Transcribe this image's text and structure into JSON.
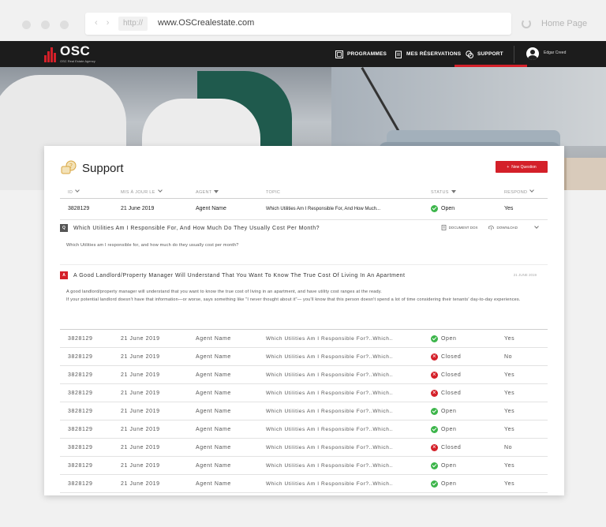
{
  "browser": {
    "protocol": "http://",
    "address": "www.OSCrealestate.com",
    "home_label": "Home Page"
  },
  "app": {
    "logo_text": "OSC",
    "logo_sub": "OSC Real Estate Agency",
    "nav": [
      {
        "label": "PROGRAMMES",
        "icon": "grid-icon"
      },
      {
        "label": "MES RÉSERVATIONS",
        "icon": "clipboard-icon"
      },
      {
        "label": "SUPPORT",
        "icon": "chat-icon",
        "active": true
      }
    ],
    "user_name": "Edgar Creed"
  },
  "page": {
    "title": "Support",
    "new_question_label": "New Question"
  },
  "table": {
    "headers": [
      "ID",
      "MIS À JOUR LE",
      "AGENT",
      "TOPIC",
      "STATUS",
      "RESPOND"
    ],
    "first_row": {
      "id": "3828129",
      "date": "21 June 2019",
      "agent": "Agent Name",
      "topic": "Which Utilities Am I Responsible For, And How Much...",
      "status": "Open",
      "respond": "Yes"
    },
    "rows": [
      {
        "id": "3828129",
        "date": "21 June 2019",
        "agent": "Agent Name",
        "topic": "Which Utilities Am I Responsible For?..Which..",
        "status": "Open",
        "respond": "Yes"
      },
      {
        "id": "3828129",
        "date": "21 June 2019",
        "agent": "Agent Name",
        "topic": "Which Utilities Am I Responsible For?..Which..",
        "status": "Closed",
        "respond": "No"
      },
      {
        "id": "3828129",
        "date": "21 June 2019",
        "agent": "Agent Name",
        "topic": "Which Utilities Am I Responsible For?..Which..",
        "status": "Closed",
        "respond": "Yes"
      },
      {
        "id": "3828129",
        "date": "21 June 2019",
        "agent": "Agent Name",
        "topic": "Which Utilities Am I Responsible For?..Which..",
        "status": "Closed",
        "respond": "Yes"
      },
      {
        "id": "3828129",
        "date": "21 June 2019",
        "agent": "Agent Name",
        "topic": "Which Utilities Am I Responsible For?..Which..",
        "status": "Open",
        "respond": "Yes"
      },
      {
        "id": "3828129",
        "date": "21 June 2019",
        "agent": "Agent Name",
        "topic": "Which Utilities Am I Responsible For?..Which..",
        "status": "Open",
        "respond": "Yes"
      },
      {
        "id": "3828129",
        "date": "21 June 2019",
        "agent": "Agent Name",
        "topic": "Which Utilities Am I Responsible For?..Which..",
        "status": "Closed",
        "respond": "No"
      },
      {
        "id": "3828129",
        "date": "21 June 2019",
        "agent": "Agent Name",
        "topic": "Which Utilities Am I Responsible For?..Which..",
        "status": "Open",
        "respond": "Yes"
      },
      {
        "id": "3828129",
        "date": "21 June 2019",
        "agent": "Agent Name",
        "topic": "Which Utilities Am I Responsible For?..Which..",
        "status": "Open",
        "respond": "Yes"
      }
    ]
  },
  "expanded": {
    "question_badge": "Q",
    "question_title": "Which Utilities Am I Responsible For, And How Much Do They Usually Cost Per Month?",
    "document_label": "DOCUMENT DOX",
    "download_label": "DOWNLOAD",
    "question_text": "Which Utilities am I responsible for, and how much do they usually cost per month?",
    "answer_badge": "A",
    "answer_title": "A Good Landlord/Property Manager Will Understand That You Want To Know The True Cost Of Living In An Apartment",
    "answer_date": "21 JUNE 2019",
    "answer_text_1": "A good landlord/property manager will understand that you want to know the true cost of living in an apartment, and have utility cost ranges at the ready.",
    "answer_text_2": "If your potential landlord doesn't have that information—or worse, says something like \"I never thought about it\"— you'll know that this person doesn't spend a lot of time considering their tenants' day-to-day experiences."
  },
  "colors": {
    "accent": "#d42029",
    "open": "#3cb54a",
    "closed": "#d42029",
    "navbar": "#1c1c1c"
  }
}
